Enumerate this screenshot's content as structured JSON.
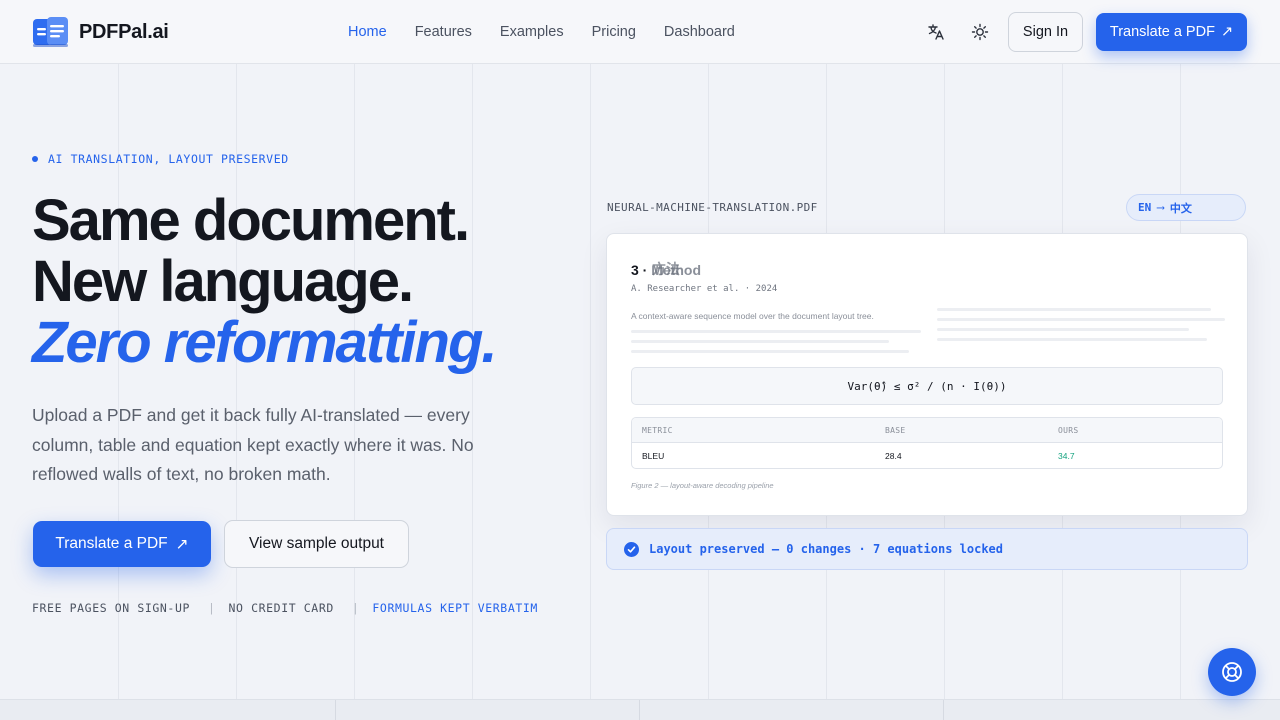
{
  "header": {
    "brand": "PDFPal.ai",
    "nav": [
      "Home",
      "Features",
      "Examples",
      "Pricing",
      "Dashboard"
    ],
    "active_nav": "Home",
    "translate_icon": "translate-icon",
    "theme_icon": "sun-icon",
    "sign_in": "Sign In",
    "cta": "Translate a PDF",
    "cta_icon": "↗"
  },
  "hero": {
    "eyebrow": "AI TRANSLATION, LAYOUT PRESERVED",
    "headline_line1": "Same document.",
    "headline_line2": "New language.",
    "headline_line3": "Zero reformatting.",
    "lead": "Upload a PDF and get it back fully AI-translated — every column, table and equation kept exactly where it was. No reflowed walls of text, no broken math.",
    "primary_button": "Translate a PDF",
    "primary_icon": "↗",
    "secondary_button": "View sample output",
    "perks": [
      "FREE PAGES ON SIGN-UP",
      "NO CREDIT CARD",
      "FORMULAS KEPT VERBATIM"
    ]
  },
  "preview": {
    "file_name": "NEURAL-MACHINE-TRANSLATION.PDF",
    "lang_from": "EN",
    "lang_arrow": "⟶",
    "lang_to": "中文",
    "doc": {
      "heading_number": "3 ·",
      "heading_en": "Method",
      "heading_zh": "方法",
      "author": "A. Researcher et al. · 2024",
      "abstract": "A context-aware sequence model over the document layout tree.",
      "formula": "Var(θ̂) ≤ σ² / (n · I(θ))",
      "table_headers": [
        "METRIC",
        "BASE",
        "OURS"
      ],
      "table_row": [
        "BLEU",
        "28.4",
        "34.7"
      ],
      "caption": "Figure 2 — layout-aware decoding pipeline"
    },
    "status": "Layout preserved — 0 changes · 7 equations locked"
  },
  "fab_icon": "lifebuoy-icon",
  "colors": {
    "accent": "#2563eb",
    "text": "#14171f",
    "muted": "#5a606c",
    "positive": "#14a37f",
    "background": "#f1f3f8"
  }
}
